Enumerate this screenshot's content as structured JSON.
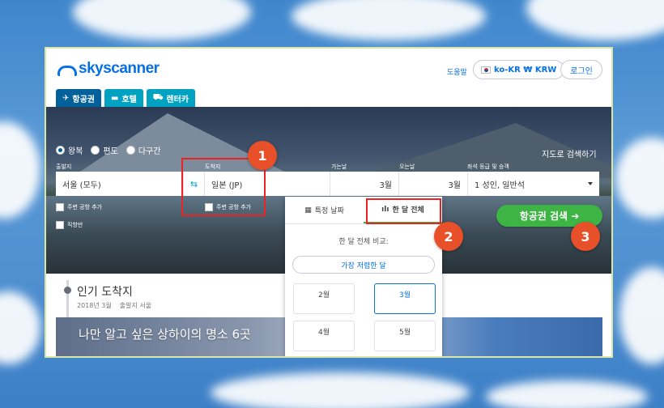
{
  "header": {
    "logo_text": "skyscanner",
    "help": "도움말",
    "locale": "ko-KR ₩ KRW",
    "login": "로그인"
  },
  "tabs": [
    {
      "label": "항공권",
      "icon": "plane-icon",
      "active": true
    },
    {
      "label": "호텔",
      "icon": "bed-icon",
      "active": false
    },
    {
      "label": "렌터카",
      "icon": "car-icon",
      "active": false
    }
  ],
  "trip_types": [
    {
      "label": "왕복",
      "selected": true
    },
    {
      "label": "편도",
      "selected": false
    },
    {
      "label": "다구간",
      "selected": false
    }
  ],
  "map_search": "지도로 검색하기",
  "search": {
    "origin_label": "출발지",
    "origin_value": "서울 (모두)",
    "dest_label": "도착지",
    "dest_value": "일본 (JP)",
    "depart_label": "가는날",
    "depart_value": "3월",
    "return_label": "오는날",
    "return_value": "3월",
    "class_label": "좌석 등급 및 승객",
    "class_value": "1 성인, 일반석"
  },
  "checkboxes": {
    "origin_nearby": "주변 공항 추가",
    "dest_nearby": "주변 공항 추가",
    "direct": "직항만"
  },
  "search_button": "항공권 검색 ➔",
  "markers": [
    "1",
    "2",
    "3"
  ],
  "date_panel": {
    "tab_specific": "특정 날짜",
    "tab_whole_month": "한 달 전체",
    "compare_label": "한 달 전체 비교:",
    "cheapest": "가장 저렴한 달",
    "months": [
      {
        "label": "2월",
        "selected": false
      },
      {
        "label": "3월",
        "selected": true
      },
      {
        "label": "4월",
        "selected": false
      },
      {
        "label": "5월",
        "selected": false
      }
    ]
  },
  "popular": {
    "title": "인기 도착지",
    "date": "2018년 3월",
    "origin": "출발지 서울",
    "banner": "나만 알고 싶은 상하이의 명소 6곳"
  },
  "colors": {
    "brand": "#0770e3",
    "tab": "#00a2c1",
    "tab_active": "#02609b",
    "search_button": "#3db443",
    "marker": "#e8502a",
    "callout": "#ee2222"
  }
}
